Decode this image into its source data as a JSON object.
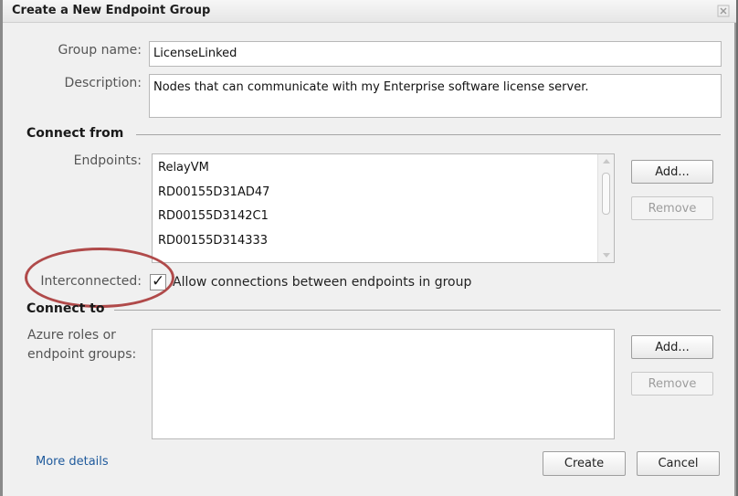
{
  "dialog": {
    "title": "Create a New Endpoint Group"
  },
  "form": {
    "group_name_label": "Group name:",
    "group_name_value": "LicenseLinked",
    "description_label": "Description:",
    "description_value": "Nodes that can communicate with my Enterprise software license server."
  },
  "connect_from": {
    "heading": "Connect from",
    "endpoints_label": "Endpoints:",
    "endpoints": [
      "RelayVM",
      "RD00155D31AD47",
      "RD00155D3142C1",
      "RD00155D314333"
    ],
    "add_label": "Add...",
    "remove_label": "Remove",
    "interconnected_label": "Interconnected:",
    "interconnected_checked": true,
    "interconnected_text": "Allow connections between endpoints in group"
  },
  "connect_to": {
    "heading": "Connect to",
    "targets_label_line1": "Azure roles or",
    "targets_label_line2": "endpoint groups:",
    "add_label": "Add...",
    "remove_label": "Remove"
  },
  "footer": {
    "more_details_label": "More details",
    "create_label": "Create",
    "cancel_label": "Cancel"
  },
  "icons": {
    "close": "close-icon",
    "check": "checkmark-icon"
  },
  "colors": {
    "highlight": "#b04a4a",
    "link": "#1f5a9c"
  }
}
